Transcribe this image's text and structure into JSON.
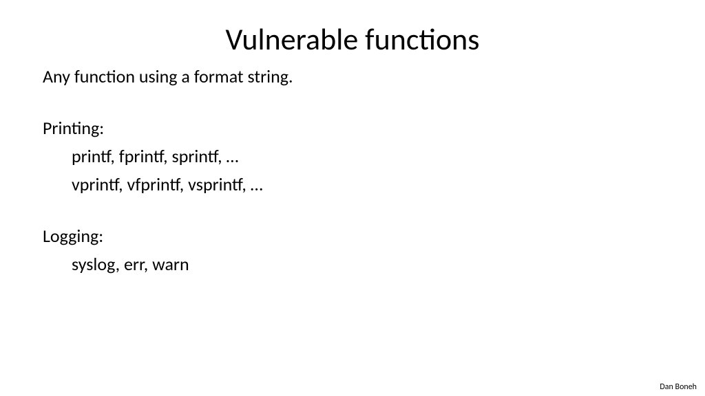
{
  "title": "Vulnerable functions",
  "lines": {
    "intro": "Any function using a format string.",
    "printingLabel": "Printing:",
    "printing1": "printf, fprintf, sprintf, …",
    "printing2": "vprintf, vfprintf, vsprintf, …",
    "loggingLabel": "Logging:",
    "logging1": "syslog,  err, warn"
  },
  "attribution": "Dan Boneh"
}
